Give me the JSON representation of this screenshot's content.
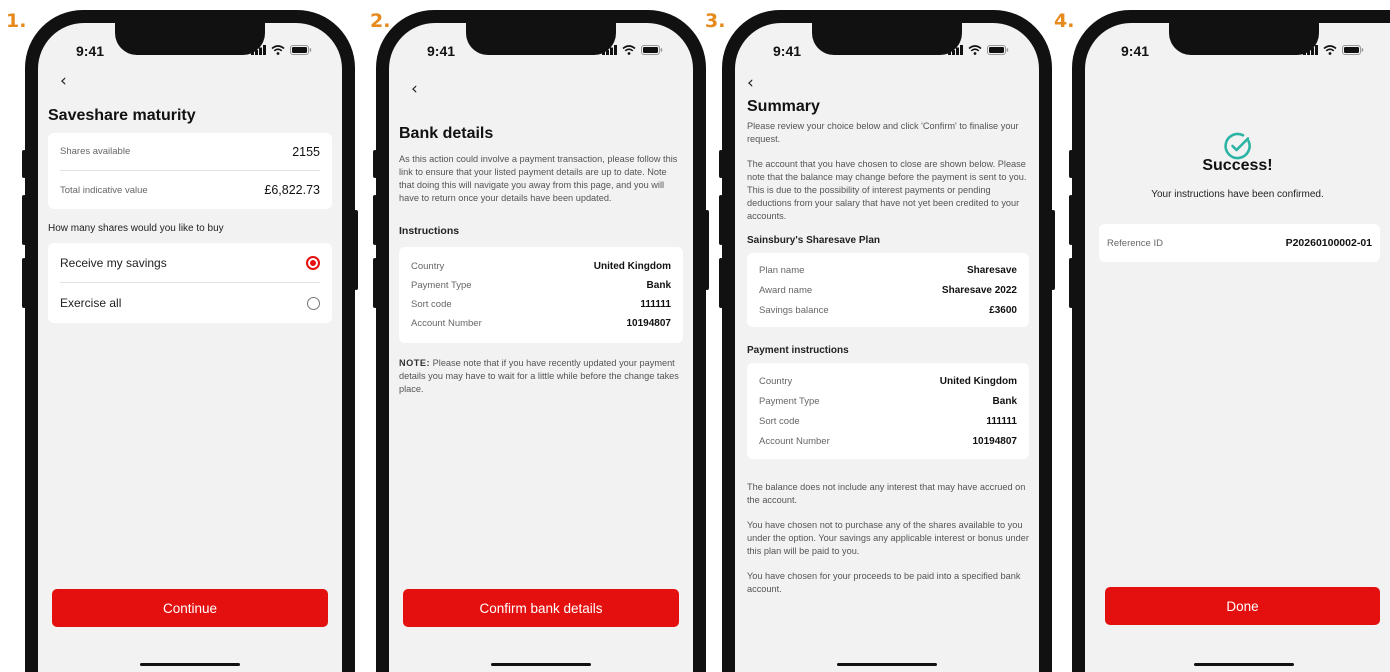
{
  "status_time": "9:41",
  "back_glyph": "‹",
  "steps": [
    "1.",
    "2.",
    "3.",
    "4."
  ],
  "screen1": {
    "title": "Saveshare maturity",
    "shares_label": "Shares available",
    "shares_value": "2155",
    "value_label": "Total indicative value",
    "value_amount": "£6,822.73",
    "question": "How many shares would you like to buy",
    "options": [
      {
        "label": "Receive my savings",
        "selected": true
      },
      {
        "label": "Exercise all",
        "selected": false
      }
    ],
    "cta": "Continue"
  },
  "screen2": {
    "title": "Bank details",
    "intro": "As this action could involve a payment transaction, please follow this link to ensure that your listed payment details are up to date. Note that doing this will navigate you away from this page, and you will have to return once your details have been updated.",
    "instructions_heading": "Instructions",
    "rows": [
      {
        "label": "Country",
        "value": "United Kingdom"
      },
      {
        "label": "Payment Type",
        "value": "Bank"
      },
      {
        "label": "Sort code",
        "value": "111111"
      },
      {
        "label": "Account Number",
        "value": "10194807"
      }
    ],
    "note_label": "NOTE:",
    "note_text": " Please note that if you have recently updated your payment details you may have to wait for a little while before the change takes place.",
    "cta": "Confirm bank details"
  },
  "screen3": {
    "title": "Summary",
    "intro1": "Please review your choice below and click 'Confirm' to finalise your request.",
    "intro2": "The account that you have chosen to close are shown below. Please note that the balance may change before the payment is sent to you. This is due to the possibility of interest payments or pending deductions from your salary that have not yet been credited to your accounts.",
    "plan_heading": "Sainsbury's Sharesave Plan",
    "plan_rows": [
      {
        "label": "Plan name",
        "value": "Sharesave"
      },
      {
        "label": "Award name",
        "value": "Sharesave 2022"
      },
      {
        "label": "Savings balance",
        "value": "£3600"
      }
    ],
    "payment_heading": "Payment instructions",
    "payment_rows": [
      {
        "label": "Country",
        "value": "United Kingdom"
      },
      {
        "label": "Payment Type",
        "value": "Bank"
      },
      {
        "label": "Sort code",
        "value": "111111"
      },
      {
        "label": "Account Number",
        "value": "10194807"
      }
    ],
    "footer1": "The balance does not include any interest that may have accrued on the account.",
    "footer2": "You have chosen not to purchase any of the shares available to you under the option. Your savings any applicable interest or bonus under this plan will be paid to you.",
    "footer3": "You have chosen for your proceeds to be paid into a specified bank account."
  },
  "screen4": {
    "title": "Success!",
    "subtitle": "Your instructions have been confirmed.",
    "ref_label": "Reference ID",
    "ref_value": "P20260100002-01",
    "cta": "Done"
  },
  "colors": {
    "accent": "#e4100f",
    "success": "#2bb3a3",
    "step": "#e68a1e"
  },
  "icons": [
    "chevron-left-icon",
    "signal-icon",
    "wifi-icon",
    "battery-icon",
    "check-circle-icon",
    "radio-selected-icon",
    "radio-unselected-icon"
  ]
}
